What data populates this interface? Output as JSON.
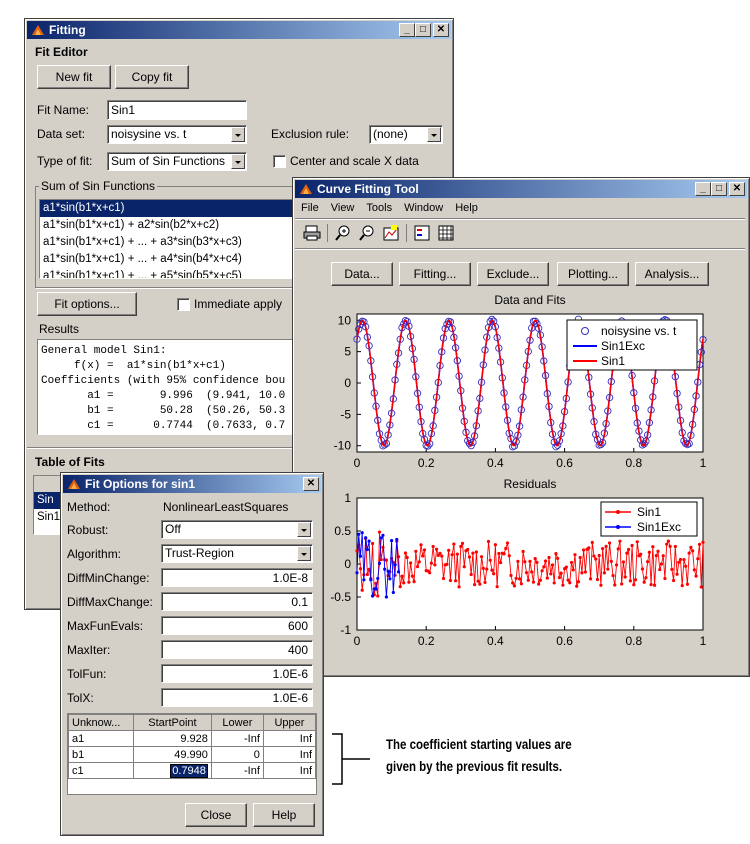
{
  "fitting": {
    "title": "Fitting",
    "editor_label": "Fit Editor",
    "new_fit": "New fit",
    "copy_fit": "Copy fit",
    "fit_name_label": "Fit Name:",
    "fit_name_value": "Sin1",
    "data_set_label": "Data set:",
    "data_set_value": "noisysine vs. t",
    "exclusion_label": "Exclusion rule:",
    "exclusion_value": "(none)",
    "type_label": "Type of fit:",
    "type_value": "Sum of Sin Functions",
    "center_scale_label": "Center and scale X data",
    "group_title": "Sum of Sin Functions",
    "models": [
      "a1*sin(b1*x+c1)",
      "a1*sin(b1*x+c1) + a2*sin(b2*x+c2)",
      "a1*sin(b1*x+c1) + ... + a3*sin(b3*x+c3)",
      "a1*sin(b1*x+c1) + ... + a4*sin(b4*x+c4)",
      "a1*sin(b1*x+c1) + ... + a5*sin(b5*x+c5)"
    ],
    "fit_options_btn": "Fit options...",
    "immediate_apply": "Immediate apply",
    "results_label": "Results",
    "results_lines": [
      "General model Sin1:",
      "     f(x) =  a1*sin(b1*x+c1)",
      "Coefficients (with 95% confidence bou",
      "       a1 =       9.996  (9.941, 10.0",
      "       b1 =       50.28  (50.26, 50.3",
      "       c1 =      0.7744  (0.7633, 0.7"
    ],
    "table_of_fits": "Table of Fits",
    "fits_rows": [
      "Sin",
      "Sin1"
    ]
  },
  "cft": {
    "title": "Curve Fitting Tool",
    "menu": [
      "File",
      "View",
      "Tools",
      "Window",
      "Help"
    ],
    "buttons": [
      "Data...",
      "Fitting...",
      "Exclude...",
      "Plotting...",
      "Analysis..."
    ]
  },
  "chart_data": [
    {
      "type": "scatter",
      "title": "Data and Fits",
      "xlim": [
        0,
        1
      ],
      "ylim": [
        -11,
        11
      ],
      "xticks": [
        "0",
        "0.2",
        "0.4",
        "0.6",
        "0.8",
        "1"
      ],
      "yticks": [
        "10",
        "5",
        "0",
        "-5",
        "-10"
      ],
      "series": [
        {
          "name": "noisysine vs. t",
          "style": "circles",
          "color": "#3030c0"
        },
        {
          "name": "Sin1Exc",
          "style": "line",
          "color": "#0000ff"
        },
        {
          "name": "Sin1",
          "style": "line",
          "color": "#ff0000"
        }
      ],
      "model": {
        "a1": 9.996,
        "b1": 50.28,
        "c1": 0.7744
      },
      "legend": "top-right"
    },
    {
      "type": "line",
      "title": "Residuals",
      "xlim": [
        0,
        1
      ],
      "ylim": [
        -1,
        1
      ],
      "xticks": [
        "0",
        "0.2",
        "0.4",
        "0.6",
        "0.8",
        "1"
      ],
      "yticks": [
        "1",
        "0.5",
        "0",
        "-0.5",
        "-1"
      ],
      "series": [
        {
          "name": "Sin1",
          "color": "#ff0000",
          "marker": "dot"
        },
        {
          "name": "Sin1Exc",
          "color": "#0000ff",
          "marker": "dot"
        }
      ],
      "legend": "top-right"
    }
  ],
  "options": {
    "title": "Fit Options for sin1",
    "method_label": "Method:",
    "method_value": "NonlinearLeastSquares",
    "robust_label": "Robust:",
    "robust_value": "Off",
    "algorithm_label": "Algorithm:",
    "algorithm_value": "Trust-Region",
    "rows": [
      {
        "label": "DiffMinChange:",
        "value": "1.0E-8"
      },
      {
        "label": "DiffMaxChange:",
        "value": "0.1"
      },
      {
        "label": "MaxFunEvals:",
        "value": "600"
      },
      {
        "label": "MaxIter:",
        "value": "400"
      },
      {
        "label": "TolFun:",
        "value": "1.0E-6"
      },
      {
        "label": "TolX:",
        "value": "1.0E-6"
      }
    ],
    "table_headers": [
      "Unknow...",
      "StartPoint",
      "Lower",
      "Upper"
    ],
    "table_rows": [
      [
        "a1",
        "9.928",
        "-Inf",
        "Inf"
      ],
      [
        "b1",
        "49.990",
        "0",
        "Inf"
      ],
      [
        "c1",
        "0.7948",
        "-Inf",
        "Inf"
      ]
    ],
    "close": "Close",
    "help": "Help"
  },
  "annotation": {
    "line1": "The coefficient starting values are",
    "line2": "given by the previous fit results."
  }
}
